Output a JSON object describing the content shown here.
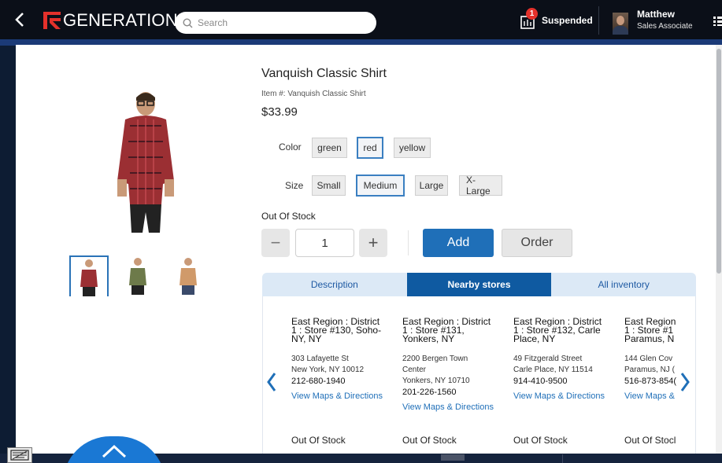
{
  "header": {
    "brand_prefix": "GENERATION",
    "brand_suffix": "N",
    "search_placeholder": "Search",
    "suspended_label": "Suspended",
    "suspended_count": "1",
    "user_name": "Matthew",
    "user_role": "Sales Associate"
  },
  "product": {
    "title": "Vanquish Classic Shirt",
    "item_number": "Item #: Vanquish Classic Shirt",
    "price": "$33.99",
    "color_label": "Color",
    "colors": [
      "green",
      "red",
      "yellow"
    ],
    "selected_color": "red",
    "size_label": "Size",
    "sizes": [
      "Small",
      "Medium",
      "Large",
      "X-Large"
    ],
    "selected_size": "Medium",
    "stock_status": "Out Of Stock",
    "quantity": "1",
    "minus_label": "−",
    "plus_label": "+",
    "add_label": "Add",
    "order_label": "Order"
  },
  "tabs": [
    {
      "label": "Description"
    },
    {
      "label": "Nearby stores"
    },
    {
      "label": "All inventory"
    }
  ],
  "active_tab": "Nearby stores",
  "stores": [
    {
      "name_l1": "East Region : District",
      "name_l2": "1 : Store #130, Soho-",
      "name_l3": "NY, NY",
      "addr_l1": "303 Lafayette St",
      "addr_l2": "New York, NY 10012",
      "phone": "212-680-1940",
      "link": "View Maps & Directions",
      "status": "Out Of Stock"
    },
    {
      "name_l1": "East Region : District",
      "name_l2": "1 : Store #131,",
      "name_l3": "Yonkers, NY",
      "addr_l1": "2200 Bergen Town",
      "addr_l2": "Center",
      "addr_l3": "Yonkers, NY 10710",
      "phone": "201-226-1560",
      "link": "View Maps & Directions",
      "status": "Out Of Stock"
    },
    {
      "name_l1": "East Region : District",
      "name_l2": "1 : Store #132, Carle",
      "name_l3": "Place, NY",
      "addr_l1": "49 Fitzgerald Street",
      "addr_l2": "Carle Place, NY 11514",
      "phone": "914-410-9500",
      "link": "View Maps & Directions",
      "status": "Out Of Stock"
    },
    {
      "name_l1": "East Region",
      "name_l2": "1 : Store #1",
      "name_l3": "Paramus, N",
      "addr_l1": "144 Glen Cov",
      "addr_l2": "Paramus, NJ (",
      "phone": "516-873-854(",
      "link": "View Maps &",
      "status": "Out Of Stocl"
    }
  ],
  "colors": {
    "brand_red": "#e4312b",
    "primary_blue": "#1f6fb8",
    "active_tab_blue": "#0f5aa1",
    "tab_inactive_bg": "#dce9f6",
    "header_bg": "#0b0f18",
    "fab_blue": "#1a78d4"
  },
  "icons": {
    "back": "chevron-left-icon",
    "search": "search-icon",
    "suspended": "suspended-cart-icon",
    "menu": "grid-menu-icon",
    "prev": "chevron-left-icon",
    "next": "chevron-right-icon",
    "keyboard": "keyboard-icon",
    "expand": "chevron-up-icon"
  }
}
